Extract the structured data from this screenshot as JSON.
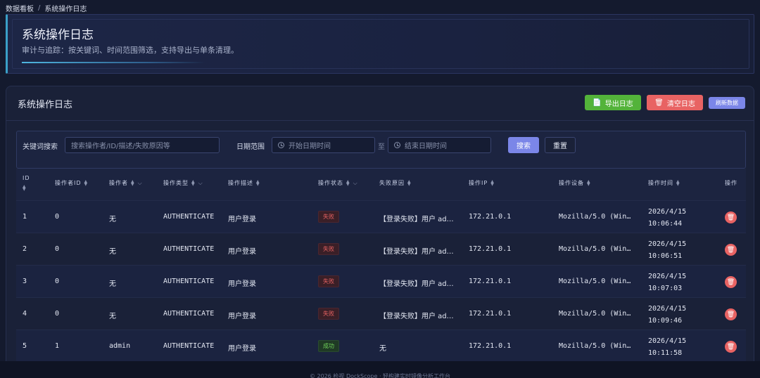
{
  "breadcrumb": {
    "root": "数据看板",
    "separator": "/",
    "current": "系统操作日志"
  },
  "hero": {
    "title": "系统操作日志",
    "subtitle": "审计与追踪：按关键词、时间范围筛选，支持导出与单条清理。"
  },
  "panel": {
    "title": "系统操作日志",
    "export_label": "导出日志",
    "clear_label": "清空日志",
    "refresh_label": "刷新数据"
  },
  "filter": {
    "keyword_label": "关键词搜索",
    "keyword_placeholder": "搜索操作者/ID/描述/失败原因等",
    "date_label": "日期范围",
    "start_placeholder": "开始日期时间",
    "to_label": "至",
    "end_placeholder": "结束日期时间",
    "search_label": "搜索",
    "reset_label": "重置"
  },
  "table": {
    "columns": [
      "ID",
      "操作者ID",
      "操作者",
      "操作类型",
      "操作描述",
      "操作状态",
      "失败原因",
      "操作IP",
      "操作设备",
      "操作时间",
      "操作"
    ],
    "rows": [
      {
        "id": "1",
        "operator_id": "0",
        "operator": "无",
        "type": "AUTHENTICATE",
        "desc": "用户登录",
        "status": "失败",
        "reason": "【登录失败】用户 ad…",
        "ip": "172.21.0.1",
        "device": "Mozilla/5.0 (Win…",
        "date": "2026/4/15",
        "time": "10:06:44"
      },
      {
        "id": "2",
        "operator_id": "0",
        "operator": "无",
        "type": "AUTHENTICATE",
        "desc": "用户登录",
        "status": "失败",
        "reason": "【登录失败】用户 ad…",
        "ip": "172.21.0.1",
        "device": "Mozilla/5.0 (Win…",
        "date": "2026/4/15",
        "time": "10:06:51"
      },
      {
        "id": "3",
        "operator_id": "0",
        "operator": "无",
        "type": "AUTHENTICATE",
        "desc": "用户登录",
        "status": "失败",
        "reason": "【登录失败】用户 ad…",
        "ip": "172.21.0.1",
        "device": "Mozilla/5.0 (Win…",
        "date": "2026/4/15",
        "time": "10:07:03"
      },
      {
        "id": "4",
        "operator_id": "0",
        "operator": "无",
        "type": "AUTHENTICATE",
        "desc": "用户登录",
        "status": "失败",
        "reason": "【登录失败】用户 ad…",
        "ip": "172.21.0.1",
        "device": "Mozilla/5.0 (Win…",
        "date": "2026/4/15",
        "time": "10:09:46"
      },
      {
        "id": "5",
        "operator_id": "1",
        "operator": "admin",
        "type": "AUTHENTICATE",
        "desc": "用户登录",
        "status": "成功",
        "reason": "无",
        "ip": "172.21.0.1",
        "device": "Mozilla/5.0 (Win…",
        "date": "2026/4/15",
        "time": "10:11:58"
      }
    ]
  },
  "footer": {
    "text": "© 2026 检视 DockScope · 轻构建实时镜像分析工作台"
  },
  "colors": {
    "accent": "#7b86e8",
    "success": "#53b33a",
    "danger": "#e86363"
  }
}
